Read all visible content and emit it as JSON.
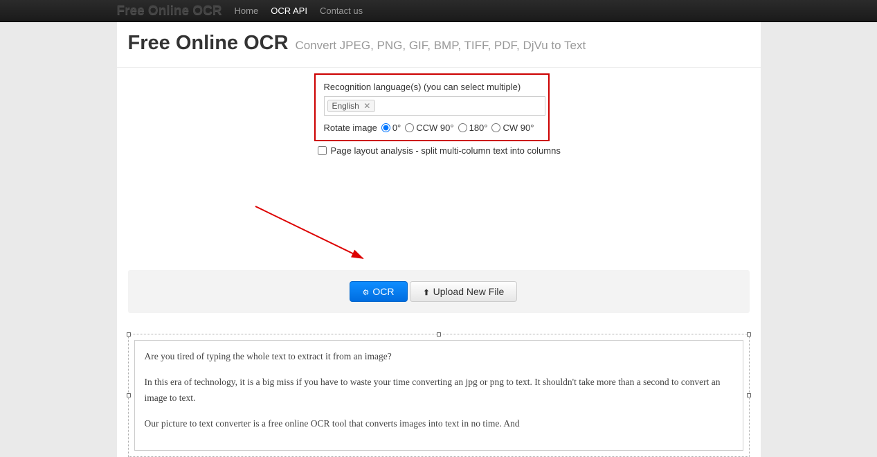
{
  "nav": {
    "brand": "Free Online OCR",
    "links": [
      "Home",
      "OCR API",
      "Contact us"
    ],
    "active_index": 1
  },
  "header": {
    "title": "Free Online OCR",
    "subtitle": "Convert JPEG, PNG, GIF, BMP, TIFF, PDF, DjVu to Text"
  },
  "settings": {
    "language_label": "Recognition language(s) (you can select multiple)",
    "selected_language": "English",
    "rotate_label": "Rotate image",
    "rotate_options": [
      "0°",
      "CCW 90°",
      "180°",
      "CW 90°"
    ],
    "rotate_selected": 0,
    "layout_checkbox": "Page layout analysis - split multi-column text into columns"
  },
  "buttons": {
    "ocr": "OCR",
    "upload": "Upload New File"
  },
  "preview": {
    "p1": "Are you tired of typing the whole text to extract it from an image?",
    "p2": "In this era of technology, it is a big miss if you have to waste your time converting an jpg or png to text. It shouldn't take more than a second to convert an image to text.",
    "p3": "Our picture to text converter is a free online OCR tool that converts images into text in no time. And"
  }
}
